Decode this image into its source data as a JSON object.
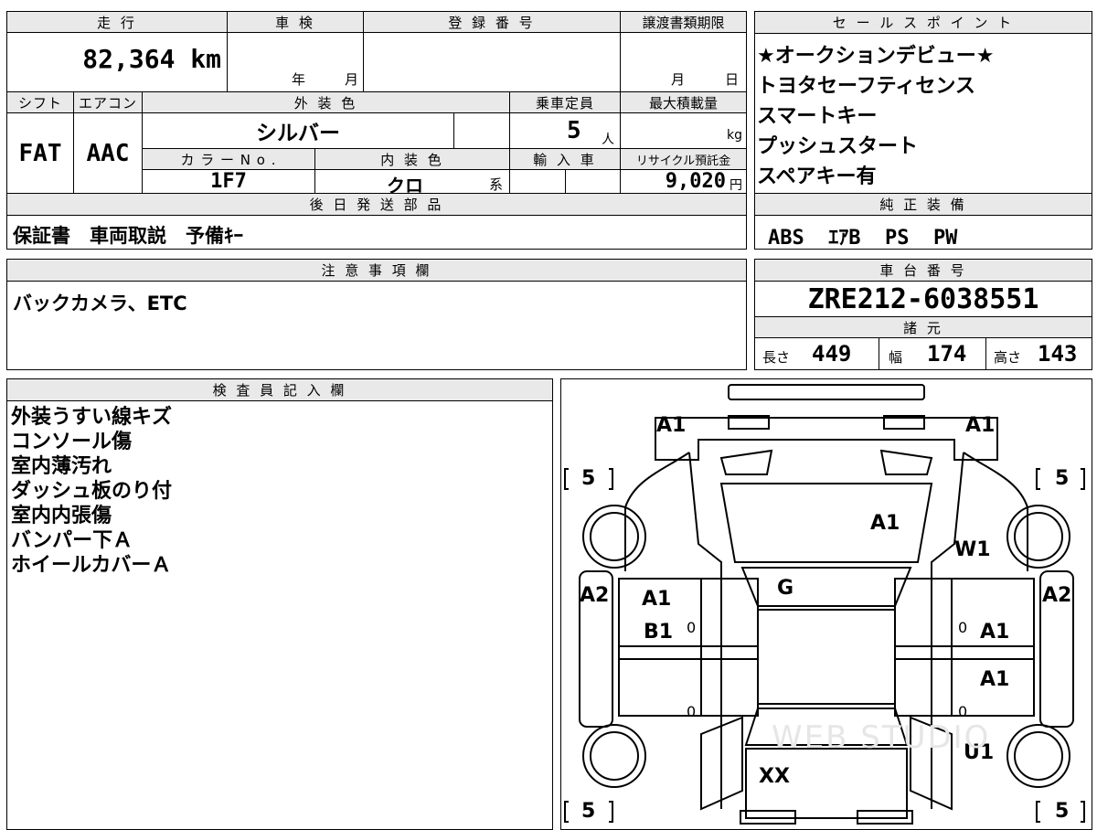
{
  "top_left": {
    "h_mileage": "走 行",
    "h_inspection": "車 検",
    "h_registration": "登 録 番 号",
    "h_transfer_docs": "譲渡書類期限",
    "mileage": "82,364 km",
    "inspection_year": "年",
    "inspection_month": "月",
    "transfer_month": "月",
    "transfer_day": "日",
    "h_shift": "シフト",
    "h_aircon": "エアコン",
    "h_exterior": "外 装 色",
    "h_capacity": "乗車定員",
    "h_max_load": "最大積載量",
    "shift": "FAT",
    "aircon": "AAC",
    "exterior_color": "シルバー",
    "capacity": "5",
    "capacity_unit": "人",
    "load_unit": "kg",
    "h_color_no": "カ ラ ー N o .",
    "h_interior": "内 装 色",
    "h_import": "輸 入 車",
    "h_recycle": "リサイクル預託金",
    "color_no": "1F7",
    "interior_color": "クロ",
    "interior_suffix": "系",
    "recycle_fee": "9,020",
    "recycle_unit": "円"
  },
  "later_parts": {
    "header": "後 日 発 送 部 品",
    "value": "保証書　車両取説　予備ｷｰ"
  },
  "notes": {
    "header": "注 意 事 項 欄",
    "value": "バックカメラ、ETC"
  },
  "sales_points": {
    "header": "セ ー ル ス ポ イ ン ト",
    "items": [
      "★オークションデビュー★",
      "トヨタセーフティセンス",
      "スマートキー",
      "プッシュスタート",
      "スペアキー有"
    ]
  },
  "genuine_equipment": {
    "header": "純 正 装 備",
    "value": "ABS  ｴｱB  PS  PW"
  },
  "chassis": {
    "header": "車 台 番 号",
    "value": "ZRE212-6038551"
  },
  "specs": {
    "header": "諸 元",
    "length_label": "長さ",
    "length": "449",
    "width_label": "幅",
    "width": "174",
    "height_label": "高さ",
    "height": "143"
  },
  "inspector": {
    "header": "検 査 員 記 入 欄",
    "items": [
      "外装うすい線キズ",
      "コンソール傷",
      "室内薄汚れ",
      "ダッシュ板のり付",
      "室内内張傷",
      "バンパー下Ａ",
      "ホイールカバーＡ"
    ]
  },
  "diagram": {
    "tl": "A1",
    "tr": "A1",
    "bl5": "5",
    "br5": "5",
    "tl5": "5",
    "tr5": "5",
    "hood": "A1",
    "w1": "W1",
    "g": "G",
    "a2l": "A2",
    "a2r": "A2",
    "door_l_1": "A1",
    "door_l_2": "B1",
    "door_r_1": "A1",
    "door_r_2": "A1",
    "u1": "U1",
    "xx": "XX",
    "zero": "0",
    "watermark": "WEB STUDIO"
  }
}
